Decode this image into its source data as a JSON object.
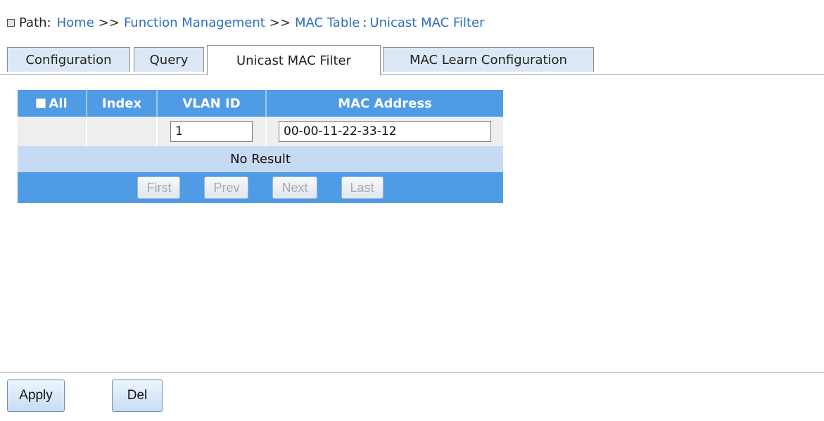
{
  "breadcrumb": {
    "label": "Path:",
    "items": [
      "Home",
      "Function Management",
      "MAC Table",
      "Unicast MAC Filter"
    ],
    "separator": ">>",
    "last_separator": ":"
  },
  "tabs": [
    {
      "label": "Configuration",
      "active": false
    },
    {
      "label": "Query",
      "active": false
    },
    {
      "label": "Unicast MAC Filter",
      "active": true
    },
    {
      "label": "MAC Learn Configuration",
      "active": false
    }
  ],
  "table": {
    "headers": {
      "all": "All",
      "index": "Index",
      "vlan_id": "VLAN ID",
      "mac_address": "MAC Address"
    },
    "input_row": {
      "vlan_id": "1",
      "mac_address": "00-00-11-22-33-12"
    },
    "empty_message": "No Result",
    "pager": {
      "first": "First",
      "prev": "Prev",
      "next": "Next",
      "last": "Last"
    }
  },
  "actions": {
    "apply": "Apply",
    "del": "Del"
  },
  "colors": {
    "header_blue": "#4f9be6",
    "link_blue": "#2d6fc0",
    "row_light_blue": "#c6daf3",
    "tab_inactive": "#dce8f5"
  }
}
